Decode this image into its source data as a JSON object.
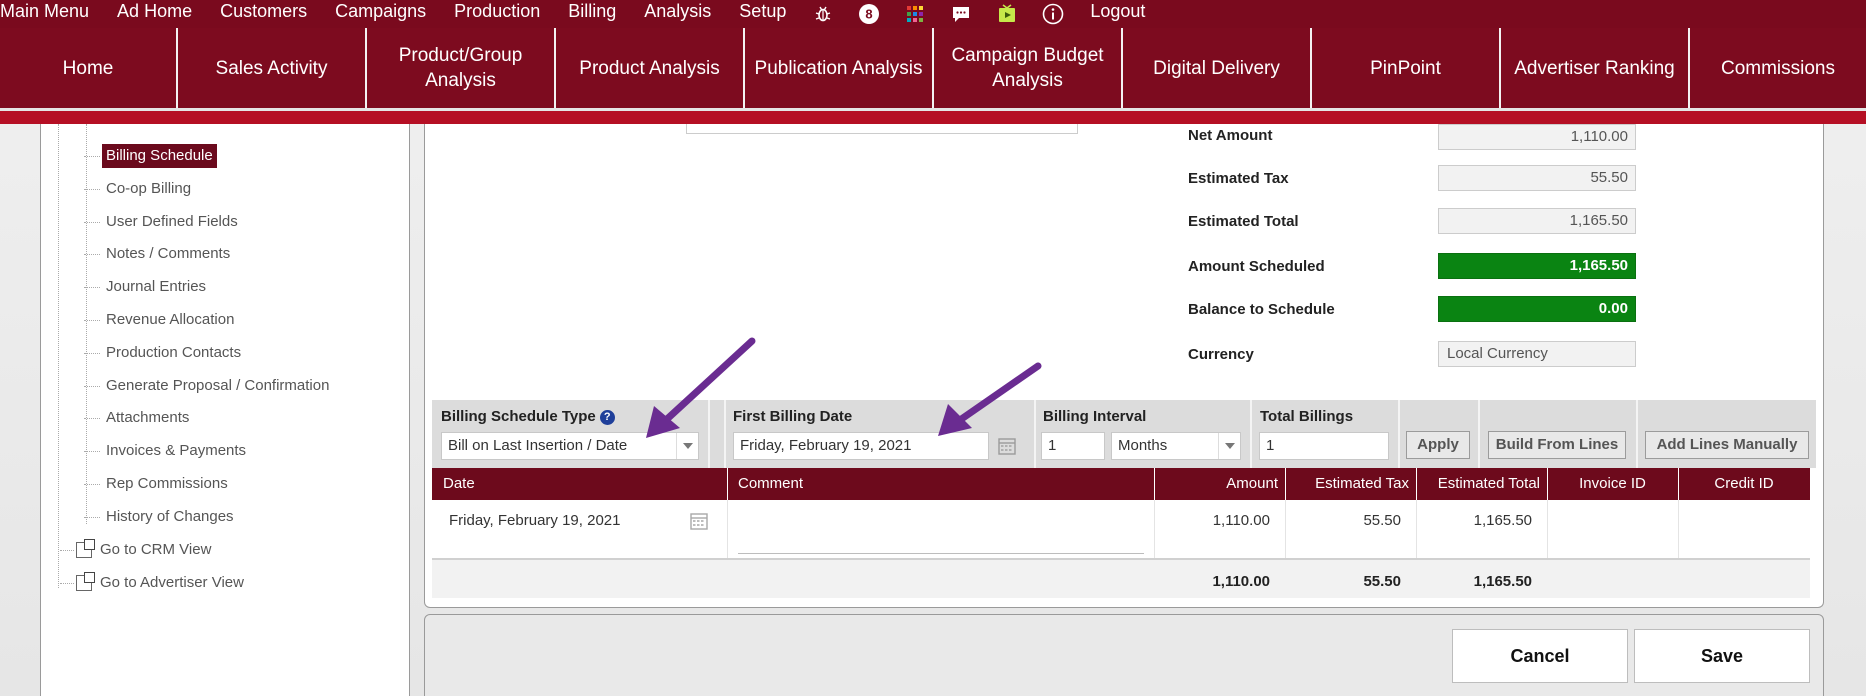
{
  "top_menu": {
    "items": [
      "Main Menu",
      "Ad Home",
      "Customers",
      "Campaigns",
      "Production",
      "Billing",
      "Analysis",
      "Setup"
    ],
    "icons": [
      "bug-icon",
      "notification-count-icon",
      "apps-grid-icon",
      "chat-icon",
      "media-play-icon",
      "info-icon"
    ],
    "badge_count": "8",
    "logout": "Logout"
  },
  "nav": {
    "home": "Home",
    "sales_activity": "Sales Activity",
    "product_group_analysis_line1": "Product/Group",
    "product_group_analysis_line2": "Analysis",
    "product_analysis": "Product Analysis",
    "publication_analysis": "Publication Analysis",
    "campaign_budget_line1": "Campaign Budget",
    "campaign_budget_line2": "Analysis",
    "digital_delivery": "Digital Delivery",
    "pinpoint": "PinPoint",
    "advertiser_ranking": "Advertiser Ranking",
    "commissions": "Commissions"
  },
  "sidebar": {
    "items": [
      "Billing Schedule",
      "Co-op Billing",
      "User Defined Fields",
      "Notes / Comments",
      "Journal Entries",
      "Revenue Allocation",
      "Production Contacts",
      "Generate Proposal / Confirmation",
      "Attachments",
      "Invoices & Payments",
      "Rep Commissions",
      "History of Changes"
    ],
    "links": [
      "Go to CRM View",
      "Go to Advertiser View"
    ]
  },
  "summary": {
    "net_amount_label": "Net Amount",
    "net_amount": "1,110.00",
    "estimated_tax_label": "Estimated Tax",
    "estimated_tax": "55.50",
    "estimated_total_label": "Estimated Total",
    "estimated_total": "1,165.50",
    "amount_scheduled_label": "Amount Scheduled",
    "amount_scheduled": "1,165.50",
    "balance_label": "Balance to Schedule",
    "balance": "0.00",
    "currency_label": "Currency",
    "currency": "Local Currency"
  },
  "billing_controls": {
    "schedule_type_label": "Billing Schedule Type",
    "schedule_type_value": "Bill on Last Insertion / Date",
    "first_billing_date_label": "First Billing Date",
    "first_billing_date_value": "Friday, February 19, 2021",
    "interval_label": "Billing Interval",
    "interval_value": "1",
    "interval_unit": "Months",
    "total_billings_label": "Total Billings",
    "total_billings_value": "1",
    "apply": "Apply",
    "build_from_lines": "Build From Lines",
    "add_lines_manually": "Add Lines Manually"
  },
  "table": {
    "columns": [
      "Date",
      "Comment",
      "Amount",
      "Estimated Tax",
      "Estimated Total",
      "Invoice ID",
      "Credit ID"
    ],
    "rows": [
      {
        "date": "Friday, February 19, 2021",
        "comment": "",
        "amount": "1,110.00",
        "tax": "55.50",
        "total": "1,165.50",
        "invoice_id": "",
        "credit_id": ""
      }
    ],
    "totals": {
      "amount": "1,110.00",
      "tax": "55.50",
      "total": "1,165.50"
    }
  },
  "footer": {
    "cancel": "Cancel",
    "save": "Save"
  },
  "colors": {
    "brand": "#7d0b1f",
    "band": "#b50f24",
    "success": "#0a8412",
    "annotation_arrow": "#6a2c91"
  }
}
